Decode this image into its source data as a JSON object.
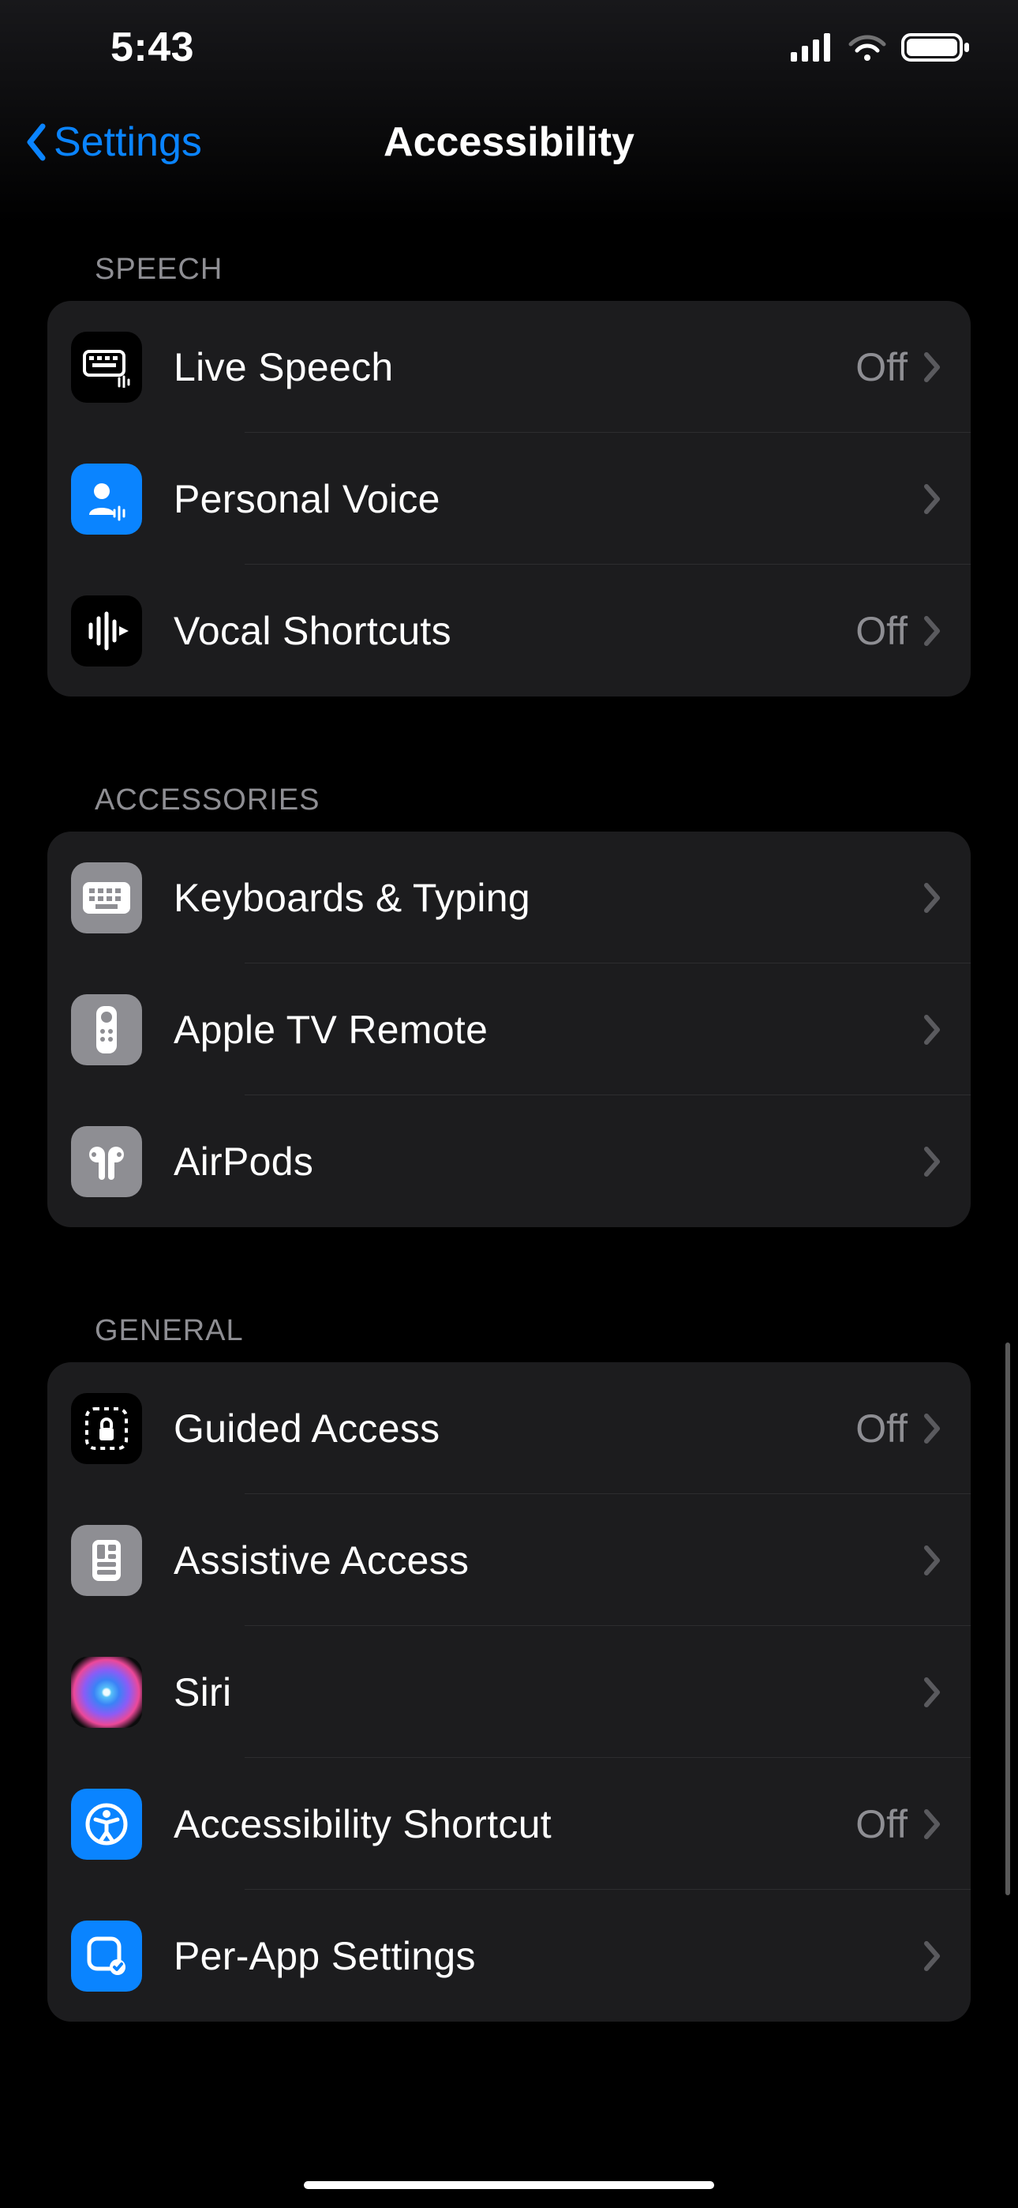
{
  "status": {
    "time": "5:43"
  },
  "nav": {
    "back_label": "Settings",
    "title": "Accessibility"
  },
  "sections": {
    "speech": {
      "header": "SPEECH",
      "items": [
        {
          "label": "Live Speech",
          "value": "Off"
        },
        {
          "label": "Personal Voice",
          "value": ""
        },
        {
          "label": "Vocal Shortcuts",
          "value": "Off"
        }
      ]
    },
    "accessories": {
      "header": "ACCESSORIES",
      "items": [
        {
          "label": "Keyboards & Typing",
          "value": ""
        },
        {
          "label": "Apple TV Remote",
          "value": ""
        },
        {
          "label": "AirPods",
          "value": ""
        }
      ]
    },
    "general": {
      "header": "GENERAL",
      "items": [
        {
          "label": "Guided Access",
          "value": "Off"
        },
        {
          "label": "Assistive Access",
          "value": ""
        },
        {
          "label": "Siri",
          "value": ""
        },
        {
          "label": "Accessibility Shortcut",
          "value": "Off"
        },
        {
          "label": "Per-App Settings",
          "value": ""
        }
      ]
    }
  },
  "icons": {
    "live_speech": "keyboard-speak-icon",
    "personal_voice": "person-voice-icon",
    "vocal_shortcuts": "waveform-icon",
    "keyboards": "keyboard-icon",
    "apple_tv": "remote-icon",
    "airpods": "airpods-icon",
    "guided_access": "lock-dashed-icon",
    "assistive_access": "panel-icon",
    "siri": "siri-icon",
    "shortcut": "accessibility-icon",
    "per_app": "app-gear-icon"
  },
  "colors": {
    "accent": "#0a84ff",
    "card": "#1c1c1e",
    "secondary_text": "#8e8e93"
  }
}
